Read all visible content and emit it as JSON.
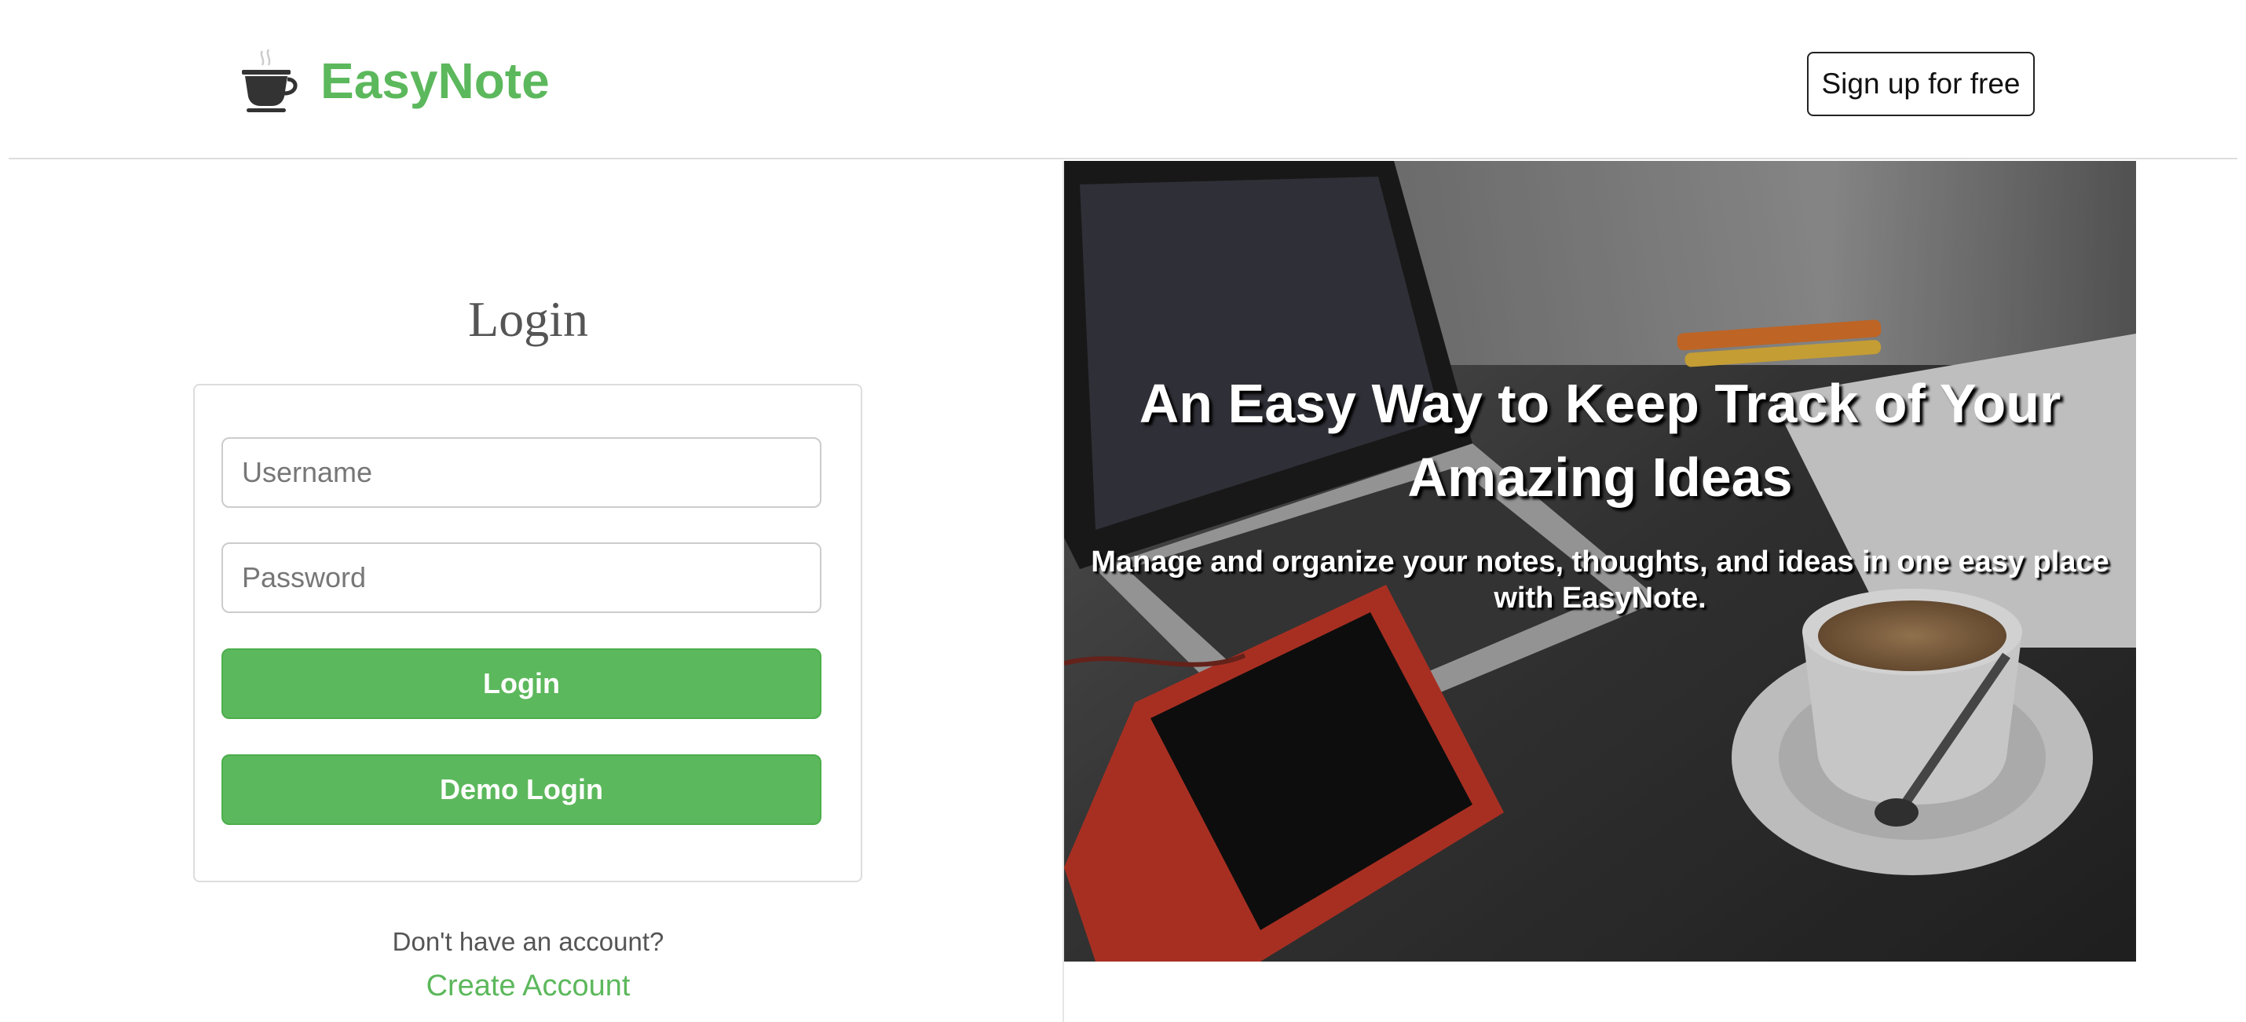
{
  "header": {
    "brand_name": "EasyNote",
    "brand_icon": "coffee-cup-icon",
    "signup_label": "Sign up for free"
  },
  "login": {
    "title": "Login",
    "username_placeholder": "Username",
    "username_value": "",
    "password_placeholder": "Password",
    "password_value": "",
    "login_label": "Login",
    "demo_label": "Demo Login",
    "no_account_text": "Don't have an account?",
    "create_account_label": "Create Account"
  },
  "hero": {
    "title": "An Easy Way to Keep Track of Your Amazing Ideas",
    "subtitle": "Manage and organize your notes, thoughts, and ideas in one easy place with EasyNote."
  },
  "colors": {
    "brand_green": "#5cb85c",
    "text_gray": "#555555",
    "border_gray": "#dddddd"
  }
}
